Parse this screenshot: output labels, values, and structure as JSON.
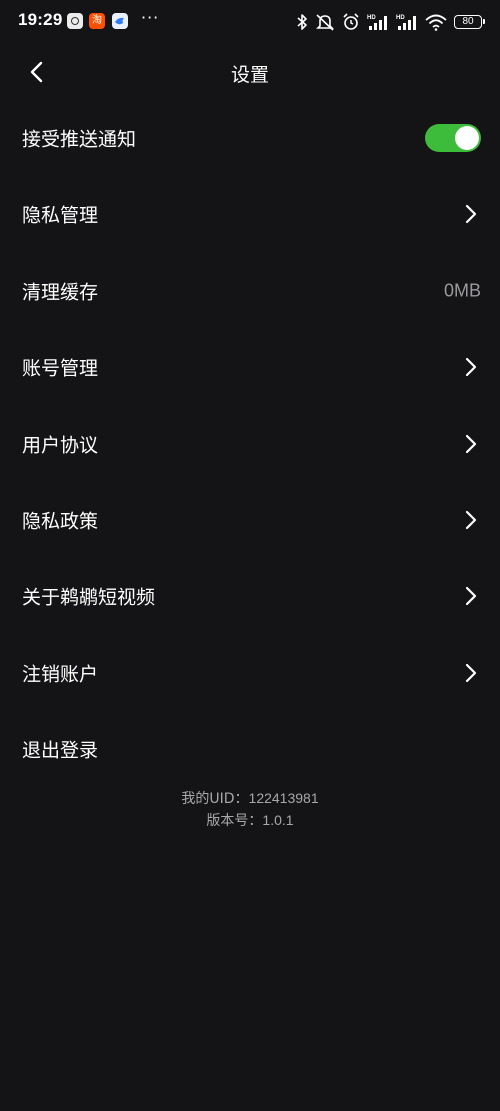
{
  "status_bar": {
    "time": "19:29",
    "taobao_glyph": "淘",
    "more": "···",
    "battery": "80",
    "icons": [
      "gallery-icon",
      "taobao-icon",
      "bird-app-icon",
      "bluetooth-icon",
      "mute-icon",
      "alarm-icon",
      "signal-hd-icon",
      "signal-hd-icon",
      "wifi-icon",
      "battery-icon"
    ]
  },
  "header": {
    "title": "设置",
    "back_icon": "chevron-left-icon"
  },
  "settings": {
    "items": [
      {
        "label": "接受推送通知",
        "control": "toggle",
        "on": true
      },
      {
        "label": "隐私管理",
        "control": "chevron"
      },
      {
        "label": "清理缓存",
        "control": "value",
        "value": "0MB"
      },
      {
        "label": "账号管理",
        "control": "chevron"
      },
      {
        "label": "用户协议",
        "control": "chevron"
      },
      {
        "label": "隐私政策",
        "control": "chevron"
      },
      {
        "label": "关于鹈鹕短视频",
        "control": "chevron"
      },
      {
        "label": "注销账户",
        "control": "chevron"
      },
      {
        "label": "退出登录",
        "control": "none"
      }
    ]
  },
  "info": {
    "uid_label": "我的UID：",
    "uid": "122413981",
    "version_label": "版本号：",
    "version": "1.0.1"
  },
  "colors": {
    "background": "#141416",
    "toggle_on": "#3dbb3a",
    "secondary_text": "#9a9a9e"
  }
}
